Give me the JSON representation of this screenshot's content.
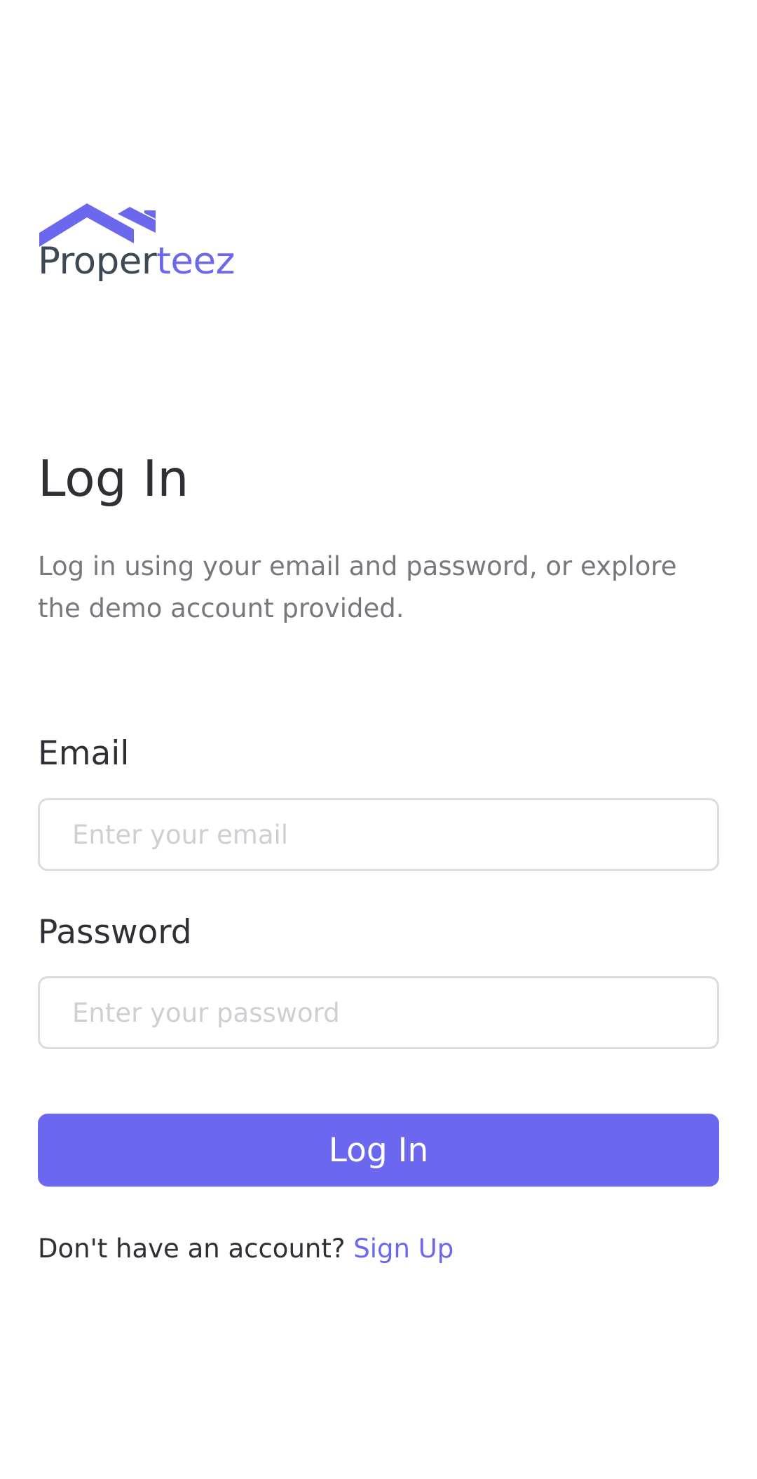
{
  "brand": {
    "name_dark": "Proper",
    "name_accent": "teez",
    "primary_color": "#6c68ed",
    "dark_color": "#3d4a55",
    "logo_icon": "house-roof-icon"
  },
  "login": {
    "title": "Log In",
    "subtitle": "Log in using your email and password, or explore the demo account provided.",
    "email_label": "Email",
    "email_placeholder": "Enter your email",
    "email_value": "",
    "password_label": "Password",
    "password_placeholder": "Enter your password",
    "password_value": "",
    "submit_label": "Log In"
  },
  "footer": {
    "prompt": "Don't have an account?",
    "signup_label": "Sign Up"
  }
}
